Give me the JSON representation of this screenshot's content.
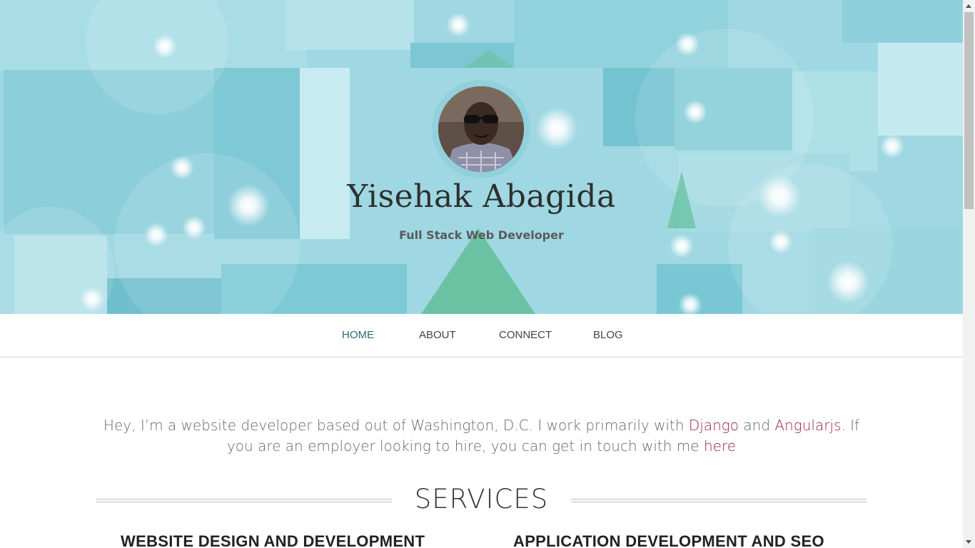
{
  "hero": {
    "name": "Yisehak Abagida",
    "tagline": "Full Stack Web Developer",
    "avatar_icon": "profile-photo",
    "background_colors": [
      "#9fd8e2",
      "#6cc3a4",
      "#ffffff"
    ]
  },
  "nav": {
    "items": [
      {
        "label": "HOME",
        "active": true
      },
      {
        "label": "ABOUT",
        "active": false
      },
      {
        "label": "CONNECT",
        "active": false
      },
      {
        "label": "BLOG",
        "active": false
      }
    ],
    "active_color": "#2a6b70"
  },
  "intro": {
    "text_1": "Hey, I’m a website developer based out of Washington, D.C. I work primarily with ",
    "link_django": "Django",
    "text_2": " and ",
    "link_angular": "Angularjs",
    "text_3": ". If you are an employer looking to hire, you can get in touch with me ",
    "link_here": "here",
    "link_color": "#9b1f4f"
  },
  "services": {
    "heading": "SERVICES",
    "items": [
      {
        "title": "WEBSITE DESIGN AND DEVELOPMENT"
      },
      {
        "title": "APPLICATION DEVELOPMENT AND SEO"
      }
    ]
  }
}
